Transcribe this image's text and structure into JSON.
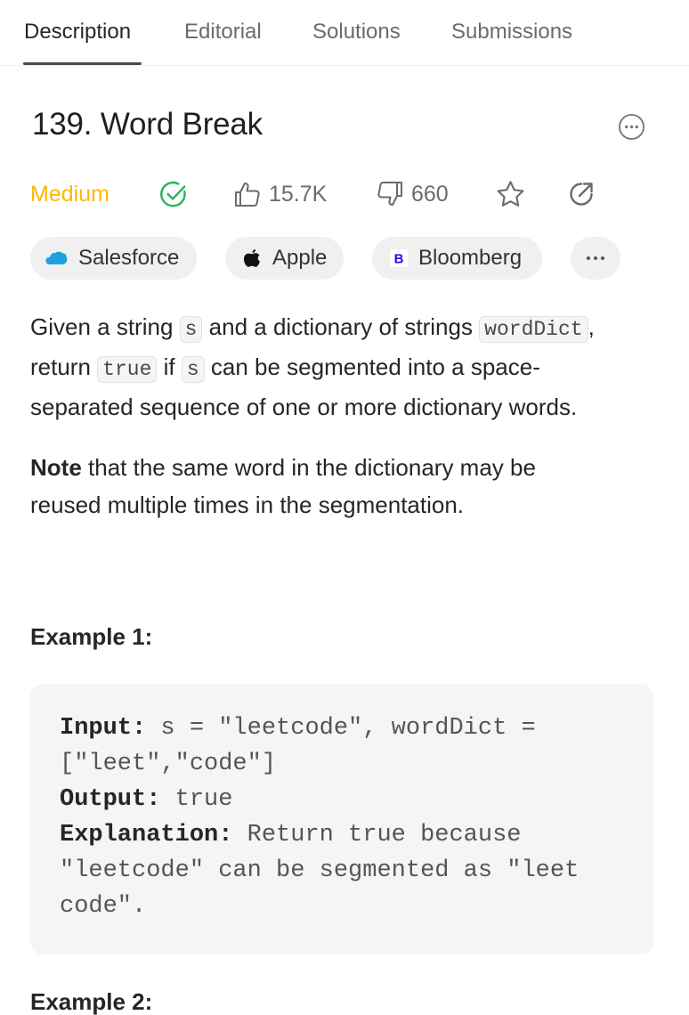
{
  "tabs": [
    {
      "label": "Description",
      "active": true
    },
    {
      "label": "Editorial",
      "active": false
    },
    {
      "label": "Solutions",
      "active": false
    },
    {
      "label": "Submissions",
      "active": false
    }
  ],
  "problem": {
    "title": "139. Word Break",
    "difficulty": "Medium",
    "difficulty_color": "#ffb800",
    "solved_color": "#2db55d",
    "likes": "15.7K",
    "dislikes": "660"
  },
  "companies": [
    {
      "name": "Salesforce",
      "icon": "salesforce-cloud-icon"
    },
    {
      "name": "Apple",
      "icon": "apple-icon"
    },
    {
      "name": "Bloomberg",
      "icon": "bloomberg-b-icon"
    }
  ],
  "description": {
    "p1": {
      "t1": "Given a string ",
      "c1": "s",
      "t2": " and a dictionary of strings ",
      "c2": "wordDict",
      "t3": ",",
      "t4": "return ",
      "c3": "true",
      "t5": " if ",
      "c4": "s",
      "t6": " can be segmented into a space-",
      "t7": "separated sequence of one or more dictionary words."
    },
    "p2": {
      "bold": "Note",
      "t1": " that the same word in the dictionary may be",
      "t2": "reused multiple times in the segmentation."
    }
  },
  "examples": [
    {
      "title": "Example 1:",
      "input_label": "Input:",
      "input_value": " s = \"leetcode\", wordDict =",
      "input_value2": "[\"leet\",\"code\"]",
      "output_label": "Output:",
      "output_value": " true",
      "explanation_label": "Explanation:",
      "explanation_value": " Return true because",
      "explanation_value2": "\"leetcode\" can be segmented as \"leet",
      "explanation_value3": "code\"."
    },
    {
      "title": "Example 2:"
    }
  ]
}
